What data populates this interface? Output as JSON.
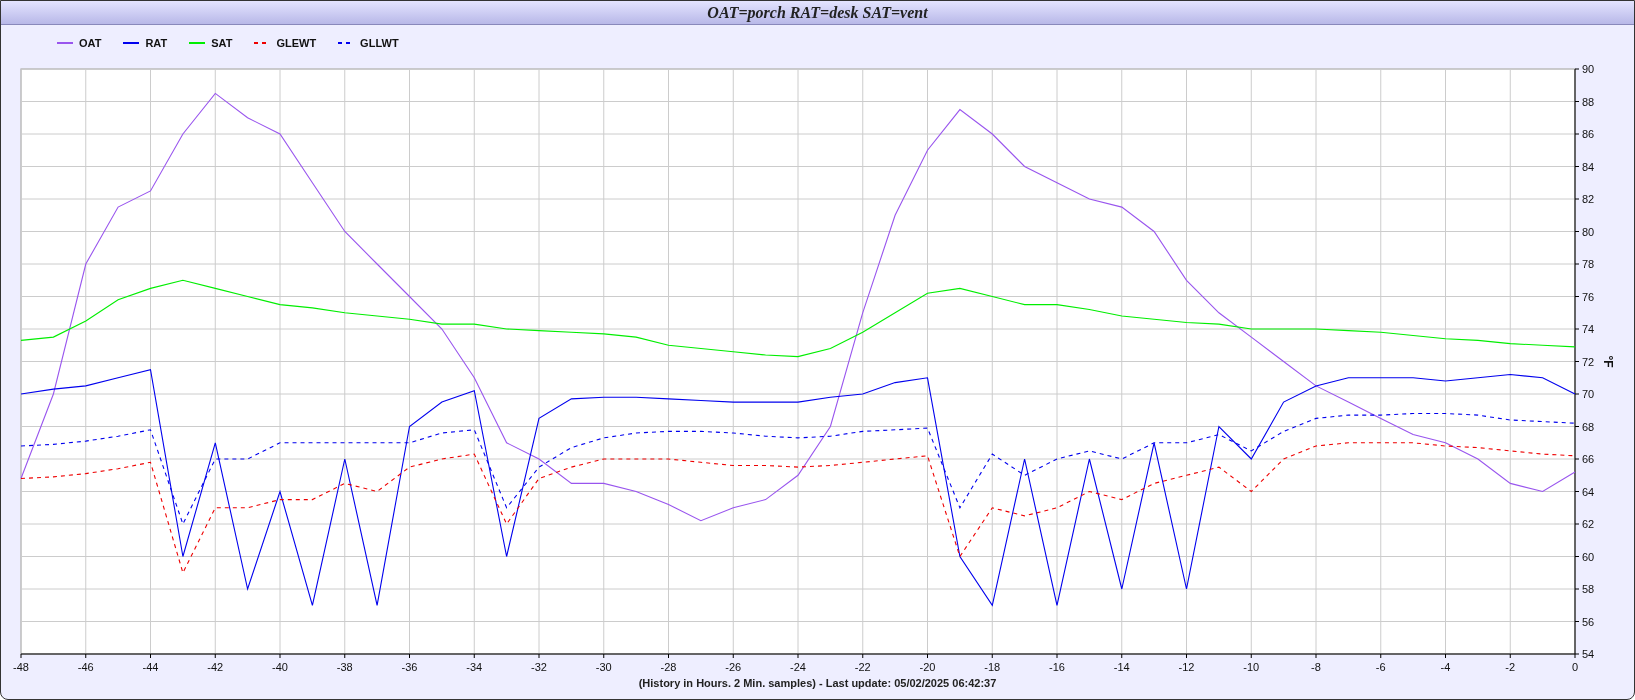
{
  "window": {
    "title": "OAT=porch RAT=desk SAT=vent"
  },
  "chart": {
    "chart_data": {
      "type": "line",
      "ylabel": "°F",
      "grid": true,
      "legend": true,
      "x": [
        -48,
        -47,
        -46,
        -45,
        -44,
        -43,
        -42,
        -41,
        -40,
        -39,
        -38,
        -37,
        -36,
        -35,
        -34,
        -33,
        -32,
        -31,
        -30,
        -29,
        -28,
        -27,
        -26,
        -25,
        -24,
        -23,
        -22,
        -21,
        -20,
        -19,
        -18,
        -17,
        -16,
        -15,
        -14,
        -13,
        -12,
        -11,
        -10,
        -9,
        -8,
        -7,
        -6,
        -5,
        -4,
        -3,
        -2,
        -1,
        0
      ],
      "series": [
        {
          "name": "OAT",
          "color": "#9955ee",
          "line_style": "solid",
          "values": [
            64.8,
            70,
            78,
            81.5,
            82.5,
            86,
            88.5,
            87,
            86,
            83,
            80,
            78,
            76,
            74,
            71,
            67,
            66,
            64.5,
            64.5,
            64,
            63.2,
            62.2,
            63,
            63.5,
            65,
            68,
            75,
            81,
            85,
            87.5,
            86,
            84,
            83,
            82,
            81.5,
            80,
            77,
            75,
            73.5,
            72,
            70.5,
            69.5,
            68.5,
            67.5,
            67,
            66,
            64.5,
            64,
            65.2
          ]
        },
        {
          "name": "RAT",
          "color": "#0000ee",
          "line_style": "solid",
          "values": [
            70,
            70.3,
            70.5,
            71,
            71.5,
            60,
            67,
            58,
            64,
            57,
            66,
            57,
            68,
            69.5,
            70.2,
            60,
            68.5,
            69.7,
            69.8,
            69.8,
            69.7,
            69.6,
            69.5,
            69.5,
            69.5,
            69.8,
            70,
            70.7,
            71,
            60,
            57,
            66,
            57,
            66,
            58,
            67,
            58,
            68,
            66,
            69.5,
            70.5,
            71,
            71,
            71,
            70.8,
            71,
            71.2,
            71,
            70
          ]
        },
        {
          "name": "SAT",
          "color": "#00ee00",
          "line_style": "solid",
          "values": [
            73.3,
            73.5,
            74.5,
            75.8,
            76.5,
            77,
            76.5,
            76,
            75.5,
            75.3,
            75,
            74.8,
            74.6,
            74.3,
            74.3,
            74,
            73.9,
            73.8,
            73.7,
            73.5,
            73,
            72.8,
            72.6,
            72.4,
            72.3,
            72.8,
            73.8,
            75,
            76.2,
            76.5,
            76,
            75.5,
            75.5,
            75.2,
            74.8,
            74.6,
            74.4,
            74.3,
            74,
            74,
            74,
            73.9,
            73.8,
            73.6,
            73.4,
            73.3,
            73.1,
            73,
            72.9
          ]
        },
        {
          "name": "GLEWT",
          "color": "#ee0000",
          "line_style": "dashed",
          "values": [
            64.8,
            64.9,
            65.1,
            65.4,
            65.8,
            59,
            63,
            63,
            63.5,
            63.5,
            64.5,
            64,
            65.5,
            66,
            66.3,
            62,
            64.8,
            65.5,
            66,
            66,
            66,
            65.8,
            65.6,
            65.6,
            65.5,
            65.6,
            65.8,
            66,
            66.2,
            60,
            63,
            62.5,
            63,
            64,
            63.5,
            64.5,
            65,
            65.5,
            64,
            66,
            66.8,
            67,
            67,
            67,
            66.8,
            66.7,
            66.5,
            66.3,
            66.2
          ]
        },
        {
          "name": "GLLWT",
          "color": "#0000ee",
          "line_style": "dashed",
          "values": [
            66.8,
            66.9,
            67.1,
            67.4,
            67.8,
            62,
            66,
            66,
            67,
            67,
            67,
            67,
            67,
            67.6,
            67.8,
            63,
            65.5,
            66.7,
            67.3,
            67.6,
            67.7,
            67.7,
            67.6,
            67.4,
            67.3,
            67.4,
            67.7,
            67.8,
            67.9,
            63,
            66.3,
            65,
            66,
            66.5,
            66,
            67,
            67,
            67.5,
            66.5,
            67.7,
            68.5,
            68.7,
            68.7,
            68.8,
            68.8,
            68.7,
            68.4,
            68.3,
            68.2
          ]
        }
      ],
      "xlim": [
        -48,
        0
      ],
      "ylim": [
        54,
        90
      ],
      "xticks": [
        -48,
        -46,
        -44,
        -42,
        -40,
        -38,
        -36,
        -34,
        -32,
        -30,
        -28,
        -26,
        -24,
        -22,
        -20,
        -18,
        -16,
        -14,
        -12,
        -10,
        -8,
        -6,
        -4,
        -2,
        0
      ],
      "yticks": [
        54,
        56,
        58,
        60,
        62,
        64,
        66,
        68,
        70,
        72,
        74,
        76,
        78,
        80,
        82,
        84,
        86,
        88,
        90
      ]
    }
  },
  "footer": "(History in Hours. 2 Min. samples) - Last update: 05/02/2025 06:42:37"
}
